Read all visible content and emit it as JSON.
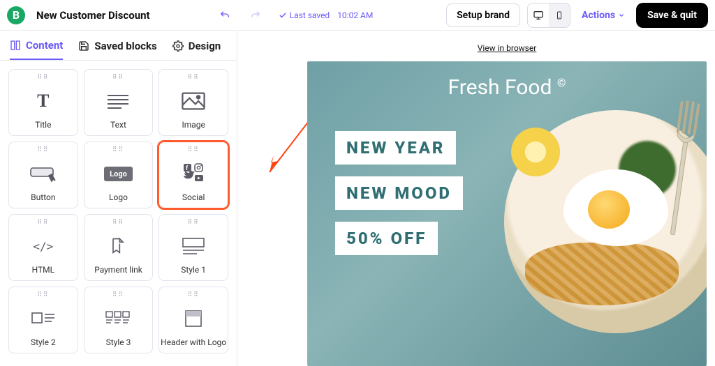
{
  "logo_letter": "B",
  "doc_title": "New Customer Discount",
  "last_saved_prefix": "Last saved",
  "last_saved_time": "10:02 AM",
  "setup_brand": "Setup brand",
  "actions": "Actions",
  "save_quit": "Save & quit",
  "tabs": {
    "content": "Content",
    "saved_blocks": "Saved blocks",
    "design": "Design"
  },
  "blocks": {
    "title": "Title",
    "text": "Text",
    "image": "Image",
    "button": "Button",
    "logo": "Logo",
    "logo_chip": "Logo",
    "social": "Social",
    "html": "HTML",
    "payment_link": "Payment link",
    "style1": "Style 1",
    "style2": "Style 2",
    "style3": "Style 3",
    "header_logo": "Header with Logo"
  },
  "preview": {
    "view_in_browser": "View in browser",
    "brand": "Fresh Food",
    "copyright": "©",
    "line1": "NEW YEAR",
    "line2": "NEW MOOD",
    "line3": "50% OFF"
  }
}
